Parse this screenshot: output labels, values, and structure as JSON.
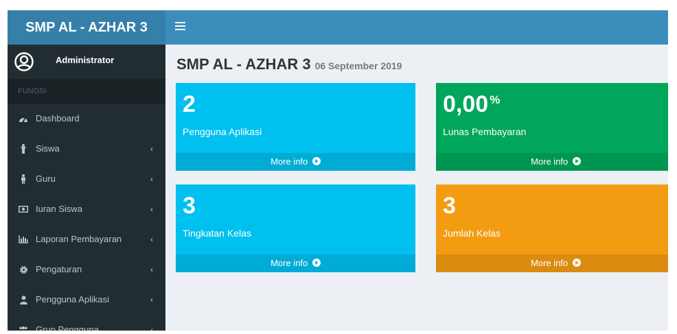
{
  "brand": {
    "title": "SMP AL - AZHAR 3"
  },
  "navbar": {
    "toggle_icon": "hamburger-icon"
  },
  "user": {
    "name": "Administrator",
    "icon": "user-circle-icon"
  },
  "sidebar": {
    "header": "FUNGSI",
    "items": [
      {
        "label": "Dashboard",
        "icon": "dashboard-icon",
        "has_submenu": false
      },
      {
        "label": "Siswa",
        "icon": "student-icon",
        "has_submenu": true
      },
      {
        "label": "Guru",
        "icon": "teacher-icon",
        "has_submenu": true
      },
      {
        "label": "Iuran Siswa",
        "icon": "money-icon",
        "has_submenu": true
      },
      {
        "label": "Laporan Pembayaran",
        "icon": "bar-chart-icon",
        "has_submenu": true
      },
      {
        "label": "Pengaturan",
        "icon": "gear-icon",
        "has_submenu": true
      },
      {
        "label": "Pengguna Aplikasi",
        "icon": "user-icon",
        "has_submenu": true
      },
      {
        "label": "Grup Pengguna",
        "icon": "users-icon",
        "has_submenu": true
      }
    ],
    "chevron": "‹"
  },
  "page": {
    "title": "SMP AL - AZHAR 3",
    "date": "06 September 2019"
  },
  "boxes": [
    {
      "number": "2",
      "suffix": "",
      "label": "Pengguna Aplikasi",
      "more": "More info",
      "color": "#00c0ef"
    },
    {
      "number": "0,00",
      "suffix": "%",
      "label": "Lunas Pembayaran",
      "more": "More info",
      "color": "#00a65a"
    },
    {
      "number": "3",
      "suffix": "",
      "label": "Tingkatan Kelas",
      "more": "More info",
      "color": "#00c0ef"
    },
    {
      "number": "3",
      "suffix": "",
      "label": "Jumlah Kelas",
      "more": "More info",
      "color": "#f39c12"
    }
  ],
  "colors": {
    "brand_bg": "#367fa9",
    "navbar_bg": "#3c8dbc",
    "sidebar_bg": "#222d32",
    "sidebar_header_bg": "#1a2226",
    "content_bg": "#ecf0f5"
  }
}
